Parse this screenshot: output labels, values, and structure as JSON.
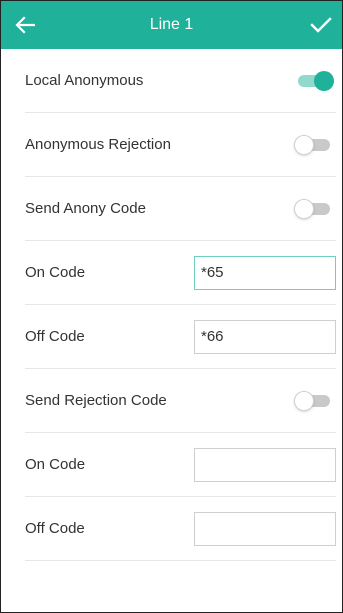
{
  "header": {
    "title": "Line 1",
    "back_icon": "arrow-left-icon",
    "confirm_icon": "checkmark-icon",
    "color": "#1fb19a"
  },
  "settings": {
    "local_anonymous": {
      "label": "Local Anonymous",
      "enabled": true
    },
    "anonymous_rejection": {
      "label": "Anonymous Rejection",
      "enabled": false
    },
    "send_anony_code": {
      "label": "Send Anony Code",
      "enabled": false
    },
    "anony_on_code": {
      "label": "On Code",
      "value": "*65",
      "focused": true
    },
    "anony_off_code": {
      "label": "Off Code",
      "value": "*66"
    },
    "send_rejection_code": {
      "label": "Send Rejection Code",
      "enabled": false
    },
    "rejection_on_code": {
      "label": "On Code",
      "value": ""
    },
    "rejection_off_code": {
      "label": "Off Code",
      "value": ""
    }
  }
}
